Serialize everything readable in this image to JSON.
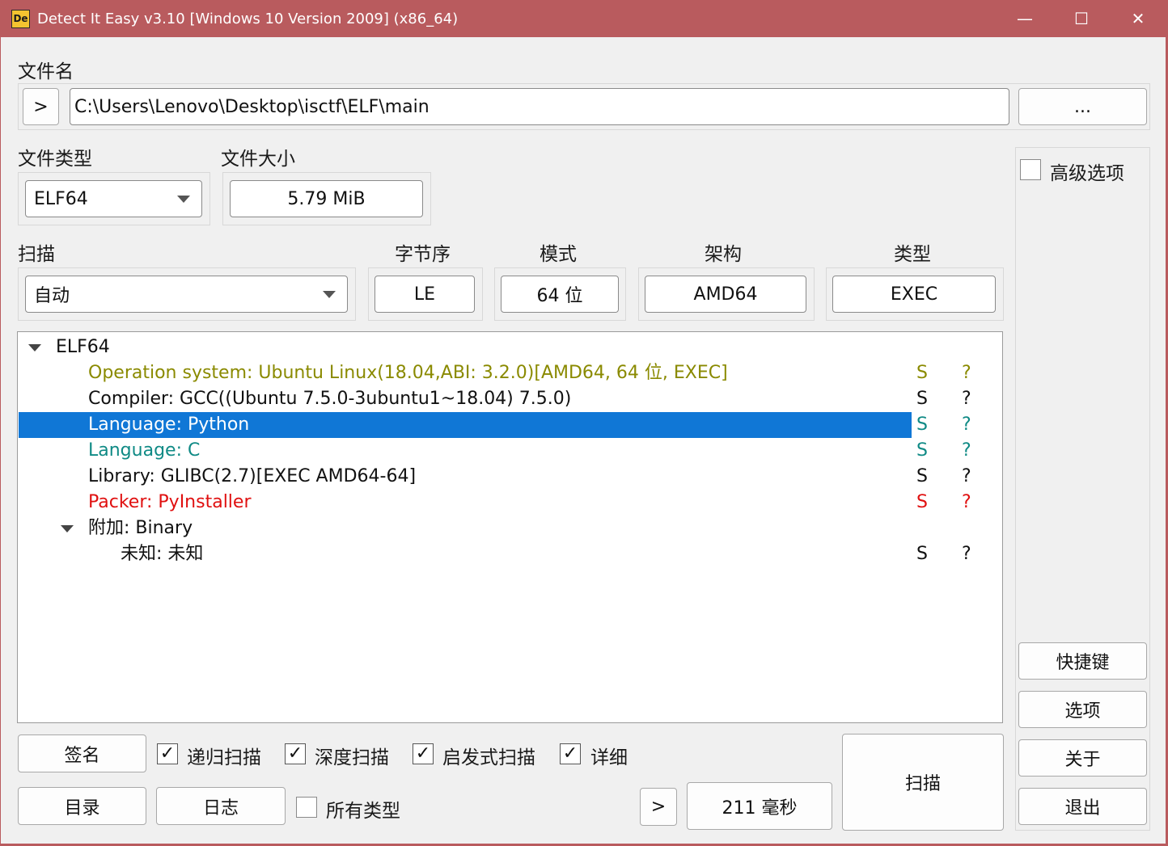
{
  "window": {
    "title": "Detect It Easy v3.10 [Windows 10 Version 2009] (x86_64)",
    "app_icon_text": "De",
    "controls": {
      "minimize": "—",
      "maximize": "☐",
      "close": "✕"
    }
  },
  "file": {
    "label": "文件名",
    "expand_button": ">",
    "path": "C:\\Users\\Lenovo\\Desktop\\isctf\\ELF\\main",
    "browse_button": "..."
  },
  "file_type": {
    "label": "文件类型",
    "value": "ELF64"
  },
  "file_size": {
    "label": "文件大小",
    "value": "5.79 MiB"
  },
  "scan_mode": {
    "label": "扫描",
    "value": "自动"
  },
  "info": {
    "endianness": {
      "label": "字节序",
      "value": "LE"
    },
    "mode": {
      "label": "模式",
      "value": "64 位"
    },
    "arch": {
      "label": "架构",
      "value": "AMD64"
    },
    "type": {
      "label": "类型",
      "value": "EXEC"
    }
  },
  "advanced": {
    "label": "高级选项",
    "checked": false
  },
  "results": {
    "root": "ELF64",
    "rows": [
      {
        "text": "Operation system: Ubuntu Linux(18.04,ABI: 3.2.0)[AMD64, 64 位, EXEC]",
        "s": "S",
        "q": "?",
        "color": "#8a8a00"
      },
      {
        "text": "Compiler: GCC((Ubuntu 7.5.0-3ubuntu1~18.04) 7.5.0)",
        "s": "S",
        "q": "?",
        "color": "#111111"
      },
      {
        "text": "Language: Python",
        "s": "S",
        "q": "?",
        "color": "#ffffff",
        "selected": true
      },
      {
        "text": "Language: C",
        "s": "S",
        "q": "?",
        "color": "#0f8a85"
      },
      {
        "text": "Library: GLIBC(2.7)[EXEC AMD64-64]",
        "s": "S",
        "q": "?",
        "color": "#111111"
      },
      {
        "text": "Packer: PyInstaller",
        "s": "S",
        "q": "?",
        "color": "#e01010"
      }
    ],
    "sub_group": "附加: Binary",
    "sub_rows": [
      {
        "text": "未知: 未知",
        "s": "S",
        "q": "?",
        "color": "#111111"
      }
    ]
  },
  "bottom": {
    "signature_button": "签名",
    "directory_button": "目录",
    "log_button": "日志",
    "recursive_scan": {
      "label": "递归扫描",
      "checked": true
    },
    "deep_scan": {
      "label": "深度扫描",
      "checked": true
    },
    "heuristic_scan": {
      "label": "启发式扫描",
      "checked": true
    },
    "verbose": {
      "label": "详细",
      "checked": true
    },
    "all_types": {
      "label": "所有类型",
      "checked": false
    },
    "more_button": ">",
    "elapsed": "211 毫秒",
    "scan_button": "扫描"
  },
  "side": {
    "shortcuts_button": "快捷键",
    "options_button": "选项",
    "about_button": "关于",
    "exit_button": "退出"
  },
  "colors": {
    "titlebar": "#b95b5e",
    "selection": "#1077d6",
    "os_row": "#8a8a00",
    "language_c": "#0f8a85",
    "packer": "#e01010"
  }
}
